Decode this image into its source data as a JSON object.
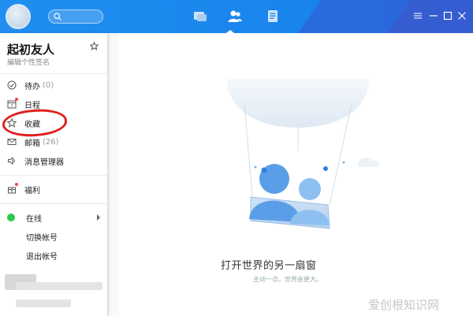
{
  "topbar": {
    "nav": [
      {
        "icon": "chat-icon",
        "active": false
      },
      {
        "icon": "contacts-icon",
        "active": true
      },
      {
        "icon": "documents-icon",
        "active": false
      }
    ],
    "window_controls": [
      "menu-icon",
      "minimize-icon",
      "maximize-icon",
      "close-icon"
    ]
  },
  "sidebar": {
    "user_name": "起初友人",
    "signature_placeholder": "编辑个性签名",
    "items": [
      {
        "label": "待办",
        "count": "(0)",
        "icon": "check-circle-icon",
        "dot": false
      },
      {
        "label": "日程",
        "count": "",
        "icon": "calendar-icon",
        "dot": true
      },
      {
        "label": "收藏",
        "count": "",
        "icon": "star-icon",
        "dot": false
      },
      {
        "label": "邮箱",
        "count": "(26)",
        "icon": "mail-icon",
        "dot": false
      },
      {
        "label": "消息管理器",
        "count": "",
        "icon": "speaker-icon",
        "dot": false
      },
      {
        "label": "福利",
        "count": "",
        "icon": "gift-icon",
        "dot": true
      }
    ],
    "status": {
      "label": "在线"
    },
    "switch_account": "切换帐号",
    "logout": "退出帐号"
  },
  "main": {
    "title": "打开世界的另一扇窗",
    "subtitle": "主动一点，世界会更大。"
  },
  "watermark": "爱创根知识网",
  "colors": {
    "primary": "#1a86ee",
    "online": "#2ec84a",
    "annotation": "#e0201e"
  }
}
